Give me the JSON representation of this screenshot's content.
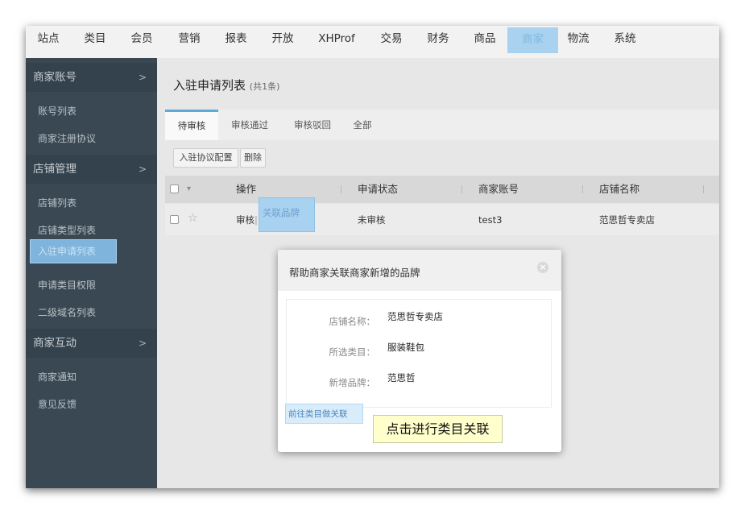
{
  "topnav": {
    "items": [
      {
        "label": "站点"
      },
      {
        "label": "类目"
      },
      {
        "label": "会员"
      },
      {
        "label": "营销"
      },
      {
        "label": "报表"
      },
      {
        "label": "开放"
      },
      {
        "label": "XHProf"
      },
      {
        "label": "交易"
      },
      {
        "label": "财务"
      },
      {
        "label": "商品"
      },
      {
        "label": "商家"
      },
      {
        "label": "物流"
      },
      {
        "label": "系统"
      }
    ],
    "active": "商家"
  },
  "sidebar": {
    "sections": [
      {
        "label": "商家账号",
        "items": [
          "账号列表",
          "商家注册协议"
        ]
      },
      {
        "label": "店铺管理",
        "items": [
          "店铺列表",
          "店铺类型列表",
          "入驻申请列表",
          "申请类目权限",
          "二级域名列表"
        ]
      },
      {
        "label": "商家互动",
        "items": [
          "商家通知",
          "意见反馈"
        ]
      }
    ],
    "active_item": "入驻申请列表",
    "chevron": ">"
  },
  "main": {
    "title": "入驻申请列表",
    "count": "(共1条)",
    "tabs": [
      "待审核",
      "审核通过",
      "审核驳回",
      "全部"
    ],
    "active_tab": "待审核",
    "toolbar": {
      "config_label": "入驻协议配置",
      "delete_label": "删除"
    },
    "table": {
      "headers": [
        "操作",
        "申请状态",
        "商家账号",
        "店铺名称"
      ],
      "rows": [
        {
          "action_review": "审核",
          "action_sep": "|",
          "action_brand": "关联品牌",
          "status": "未审核",
          "account": "test3",
          "shop": "范思哲专卖店"
        }
      ]
    }
  },
  "modal": {
    "title": "帮助商家关联商家新增的品牌",
    "close": "×",
    "fields": [
      {
        "label": "店铺名称：",
        "value": "范思哲专卖店"
      },
      {
        "label": "所选类目：",
        "value": "服装鞋包"
      },
      {
        "label": "新增品牌：",
        "value": "范思哲"
      }
    ],
    "goto_link": "前往类目做关联",
    "callout": "点击进行类目关联"
  },
  "colors": {
    "sidebar_bg": "#3a4853",
    "highlight": "#a8d2ef",
    "link": "#5c8fc4",
    "callout_bg": "#ffffcc"
  }
}
